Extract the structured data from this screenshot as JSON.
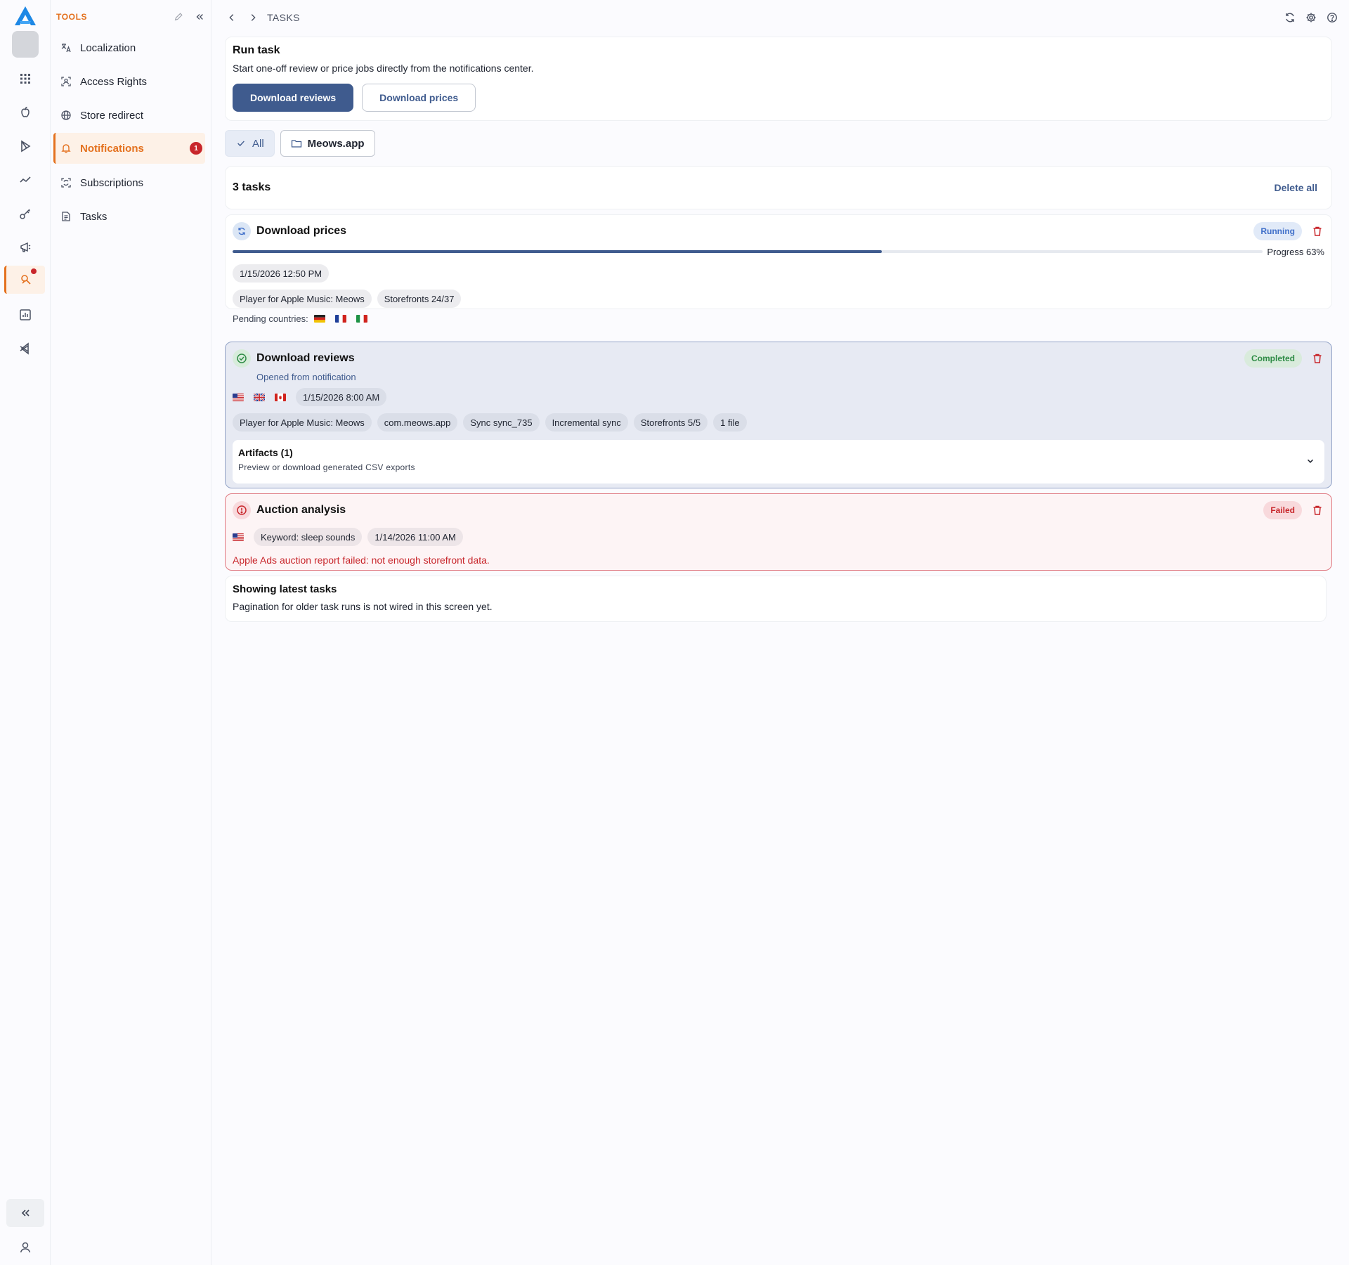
{
  "sidebar": {
    "title": "TOOLS",
    "items": [
      {
        "label": "Localization",
        "icon": "translate-icon"
      },
      {
        "label": "Access Rights",
        "icon": "access-icon"
      },
      {
        "label": "Store redirect",
        "icon": "globe-icon"
      },
      {
        "label": "Notifications",
        "icon": "bell-icon",
        "badge": "1"
      },
      {
        "label": "Subscriptions",
        "icon": "subscriptions-icon"
      },
      {
        "label": "Tasks",
        "icon": "tasks-icon"
      }
    ]
  },
  "header": {
    "breadcrumb": "TASKS"
  },
  "run_task": {
    "title": "Run task",
    "description": "Start one-off review or price jobs directly from the notifications center.",
    "primary_button": "Download reviews",
    "secondary_button": "Download prices"
  },
  "filters": {
    "all_label": "All",
    "app_label": "Meows.app"
  },
  "tasks_summary": {
    "count_label": "3 tasks",
    "delete_all_label": "Delete all"
  },
  "tasks": [
    {
      "title": "Download prices",
      "status": "Running",
      "progress_label": "Progress 63%",
      "progress_percent": 63,
      "date": "1/15/2026 12:50 PM",
      "chips": [
        "Player for Apple Music: Meows",
        "Storefronts 24/37"
      ],
      "pending_label": "Pending countries:",
      "pending_flags": [
        "de",
        "fr",
        "it"
      ]
    },
    {
      "title": "Download reviews",
      "status": "Completed",
      "subtitle": "Opened from notification",
      "flags": [
        "us",
        "gb",
        "ca"
      ],
      "date": "1/15/2026 8:00 AM",
      "chips": [
        "Player for Apple Music: Meows",
        "com.meows.app",
        "Sync sync_735",
        "Incremental sync",
        "Storefronts 5/5",
        "1 file"
      ],
      "artifacts_title": "Artifacts (1)",
      "artifacts_desc": "Preview or download generated CSV exports"
    },
    {
      "title": "Auction analysis",
      "status": "Failed",
      "flags": [
        "us"
      ],
      "chips": [
        "Keyword: sleep sounds",
        "1/14/2026 11:00 AM"
      ],
      "error": "Apple Ads auction report failed: not enough storefront data."
    }
  ],
  "footer_info": {
    "title": "Showing latest tasks",
    "description": "Pagination for older task runs is not wired in this screen yet."
  },
  "colors": {
    "accent": "#e4711e",
    "primary": "#3f5b8e",
    "danger": "#c8262b",
    "success": "#2e8b45"
  }
}
